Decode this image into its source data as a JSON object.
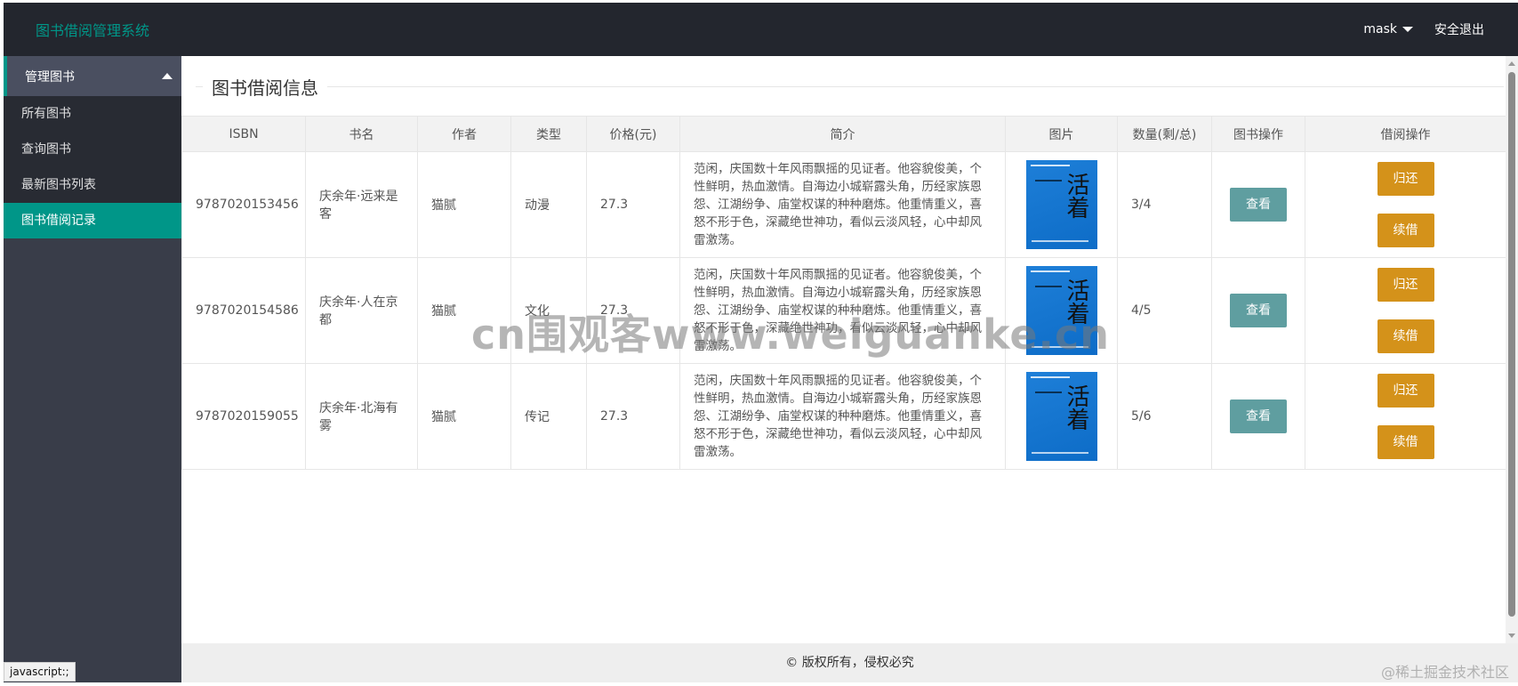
{
  "header": {
    "logo": "图书借阅管理系统",
    "user": "mask",
    "logout": "安全退出"
  },
  "sidebar": {
    "group": "管理图书",
    "items": [
      {
        "label": "所有图书"
      },
      {
        "label": "查询图书"
      },
      {
        "label": "最新图书列表"
      },
      {
        "label": "图书借阅记录"
      }
    ]
  },
  "main": {
    "legend": "图书借阅信息",
    "columns": [
      "ISBN",
      "书名",
      "作者",
      "类型",
      "价格(元)",
      "简介",
      "图片",
      "数量(剩/总)",
      "图书操作",
      "借阅操作"
    ],
    "cover_title": "活着",
    "actions": {
      "view": "查看",
      "return": "归还",
      "renew": "续借"
    },
    "rows": [
      {
        "isbn": "9787020153456",
        "name": "庆余年·远来是客",
        "author": "猫腻",
        "type": "动漫",
        "price": "27.3",
        "desc": "范闲，庆国数十年风雨飘摇的见证者。他容貌俊美，个性鲜明，热血激情。自海边小城崭露头角，历经家族恩怨、江湖纷争、庙堂权谋的种种磨炼。他重情重义，喜怒不形于色，深藏绝世神功，看似云淡风轻，心中却风雷激荡。",
        "qty": "3/4"
      },
      {
        "isbn": "9787020154586",
        "name": "庆余年·人在京都",
        "author": "猫腻",
        "type": "文化",
        "price": "27.3",
        "desc": "范闲，庆国数十年风雨飘摇的见证者。他容貌俊美，个性鲜明，热血激情。自海边小城崭露头角，历经家族恩怨、江湖纷争、庙堂权谋的种种磨炼。他重情重义，喜怒不形于色，深藏绝世神功，看似云淡风轻，心中却风雷激荡。",
        "qty": "4/5"
      },
      {
        "isbn": "9787020159055",
        "name": "庆余年·北海有雾",
        "author": "猫腻",
        "type": "传记",
        "price": "27.3",
        "desc": "范闲，庆国数十年风雨飘摇的见证者。他容貌俊美，个性鲜明，热血激情。自海边小城崭露头角，历经家族恩怨、江湖纷争、庙堂权谋的种种磨炼。他重情重义，喜怒不形于色，深藏绝世神功，看似云淡风轻，心中却风雷激荡。",
        "qty": "5/6"
      }
    ]
  },
  "footer": {
    "text": "© 版权所有，侵权必究"
  },
  "statusbar": {
    "text": "javascript:;"
  },
  "watermarks": {
    "center": "cn围观客www.weiguanke.cn",
    "corner": "@稀土掘金技术社区"
  }
}
